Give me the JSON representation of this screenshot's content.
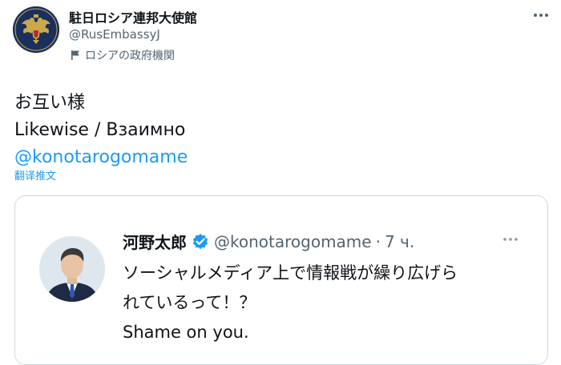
{
  "tweet": {
    "author": {
      "name": "駐日ロシア連邦大使館",
      "handle": "@RusEmbassyJ",
      "label": "ロシアの政府機関"
    },
    "text_lines": [
      "お互い様",
      "Likewise / Взаимно"
    ],
    "mention": "@konotarogomame",
    "translate_label": "翻译推文",
    "more_icon": "more-horizontal-icon",
    "label_icon": "government-flag-icon"
  },
  "quoted_tweet": {
    "author": {
      "name": "河野太郎",
      "handle": "@konotarogomame",
      "verified": true
    },
    "separator": "·",
    "time": "7 ч.",
    "text_lines": [
      "ソーシャルメディア上で情報戦が繰り広げら",
      "れているって！？",
      "Shame on you."
    ]
  },
  "colors": {
    "link": "#1d9bf0",
    "secondary_text": "#536471",
    "border": "#cfd9de",
    "verified": "#1d9bf0"
  }
}
